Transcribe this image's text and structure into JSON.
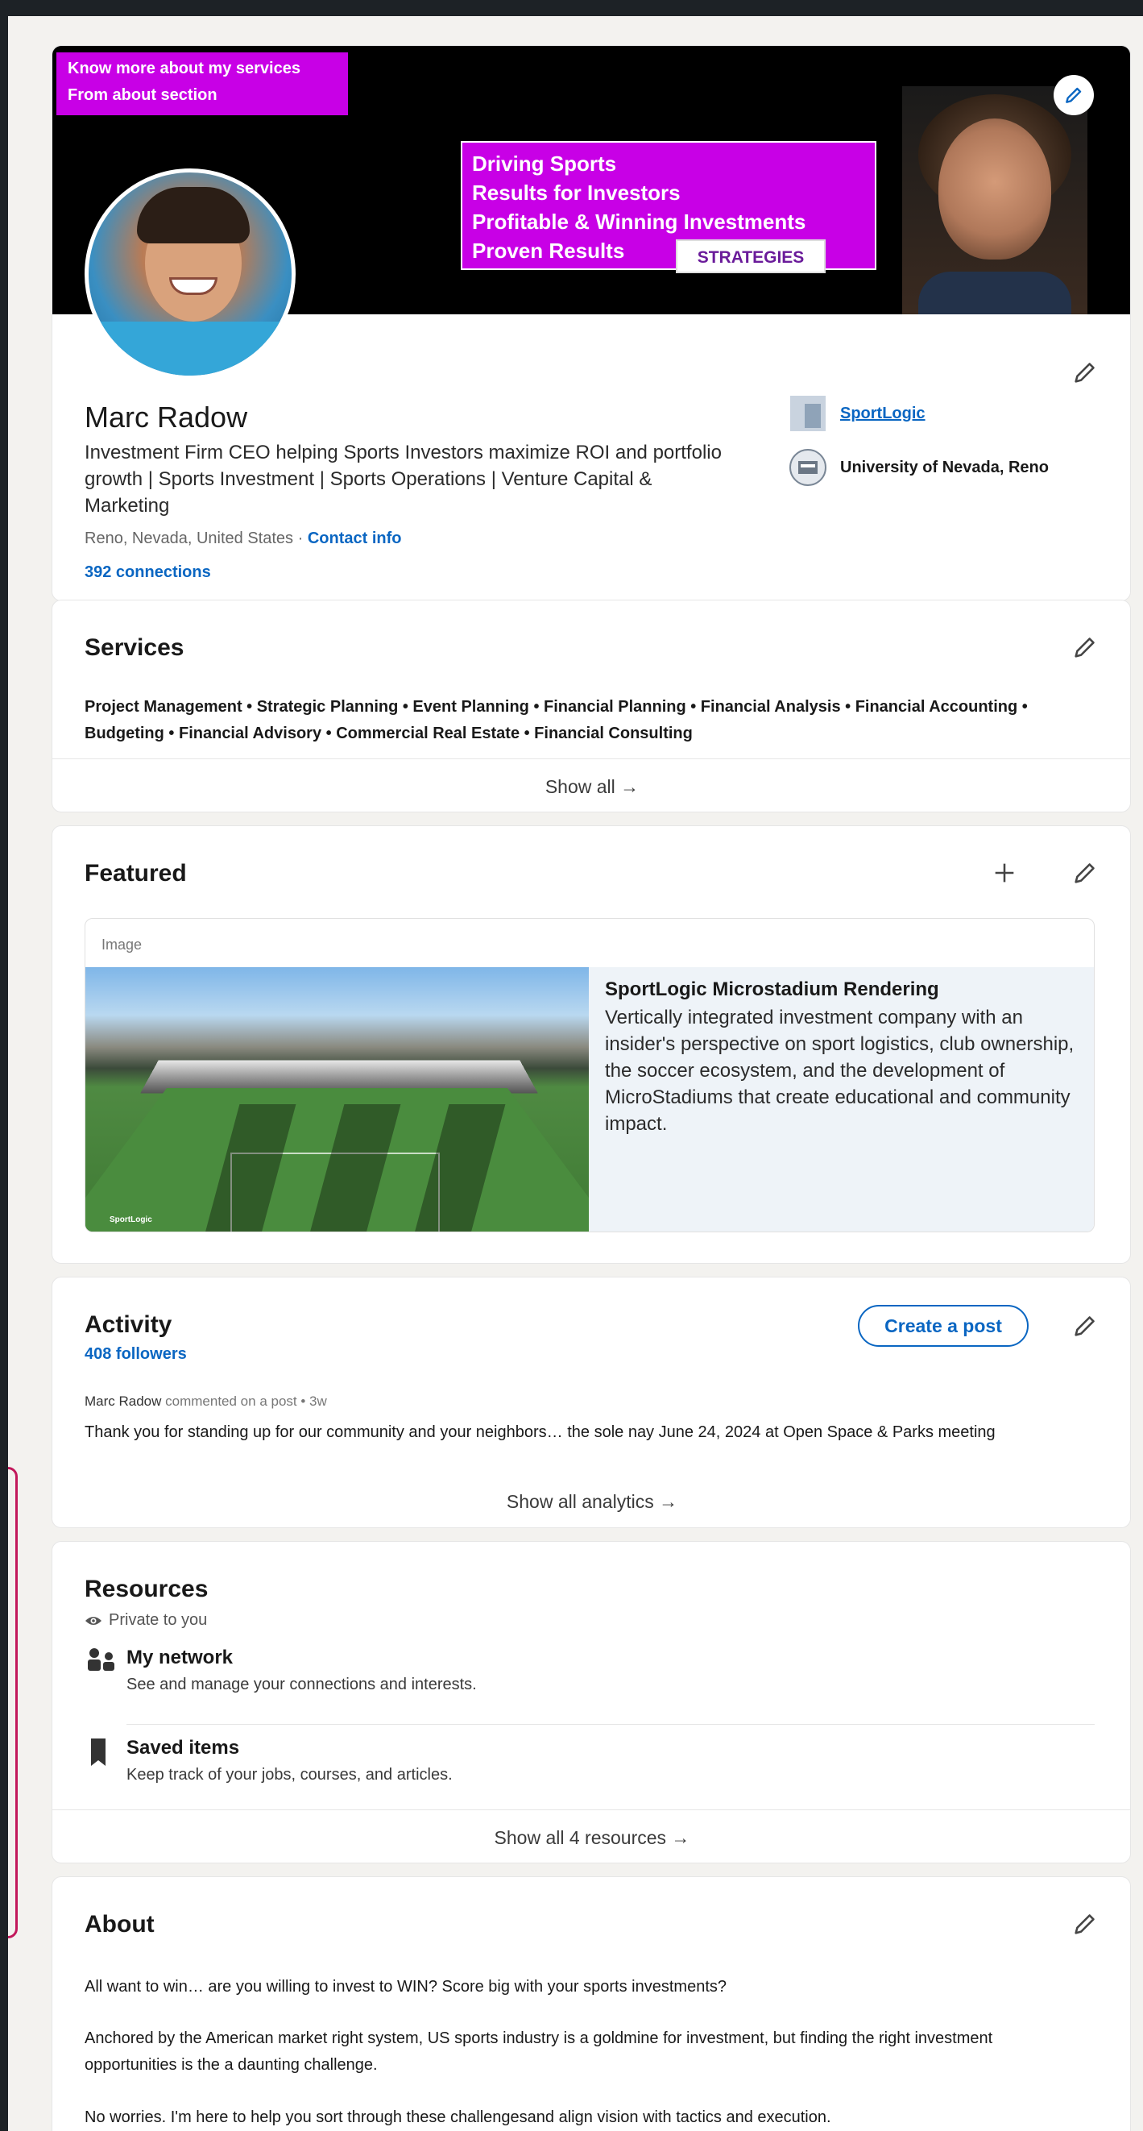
{
  "banner": {
    "tag_line1": "Know more about my services",
    "tag_line2": "From about section",
    "box_lines": [
      "Driving Sports",
      "Results for Investors",
      "Profitable & Winning Investments",
      "Proven Results"
    ],
    "box_badge": "STRATEGIES"
  },
  "profile": {
    "name": "Marc Radow",
    "headline": "Investment Firm CEO helping Sports Investors maximize ROI and portfolio growth | Sports Investment | Sports Operations | Venture Capital & Marketing",
    "location": "Reno, Nevada, United States",
    "separator": " · ",
    "contact_link": "Contact info",
    "connections": "392 connections",
    "company": "SportLogic",
    "school": "University of Nevada, Reno"
  },
  "services": {
    "title": "Services",
    "list": "Project Management • Strategic Planning • Event Planning • Financial Planning • Financial Analysis • Financial Accounting • Budgeting • Financial Advisory • Commercial Real Estate • Financial Consulting",
    "show_all": "Show all →"
  },
  "featured": {
    "title": "Featured",
    "item_type": "Image",
    "item_title": "SportLogic Microstadium Rendering",
    "item_desc": "Vertically integrated investment company with an insider's perspective on sport logistics, club ownership, the soccer ecosystem, and the development of MicroStadiums that create educational and community impact.",
    "image_brand": "SportLogic"
  },
  "activity": {
    "title": "Activity",
    "followers": "408 followers",
    "create_post": "Create a post",
    "post_author": "Marc Radow",
    "post_meta": " commented on a post • 3w",
    "post_text": "Thank you for standing up for our community and your neighbors… the sole nay June 24, 2024 at Open Space & Parks meeting",
    "show_all": "Show all analytics →"
  },
  "resources": {
    "title": "Resources",
    "privacy": "Private to you",
    "items": [
      {
        "title": "My network",
        "desc": "See and manage your connections and interests."
      },
      {
        "title": "Saved items",
        "desc": "Keep track of your jobs, courses, and articles."
      }
    ],
    "show_all": "Show all 4 resources →"
  },
  "about": {
    "title": "About",
    "paragraphs": [
      "All want to win… are you willing to invest to WIN? Score big with your sports investments?",
      "Anchored by the American market right system, US sports industry is a goldmine for investment, but finding the right investment opportunities is the a daunting challenge.",
      "No worries. I'm here to help you sort through these challengesand align vision with tactics and execution."
    ]
  },
  "colors": {
    "accent": "#0a66c2",
    "banner_magenta": "#c800e6",
    "page_bg": "#f3f2ef"
  }
}
